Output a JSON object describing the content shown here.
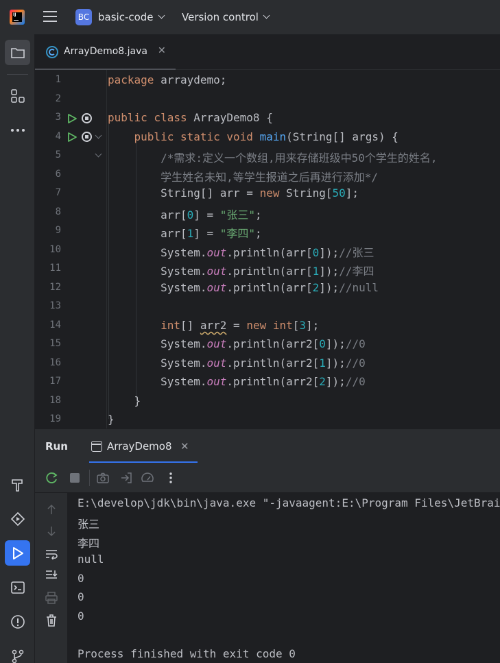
{
  "titlebar": {
    "project_badge": "BC",
    "project_name": "basic-code",
    "vcs_label": "Version control"
  },
  "editor": {
    "tab_label": "ArrayDemo8.java",
    "tab_close": "✕",
    "line_numbers": [
      "1",
      "2",
      "3",
      "4",
      "5",
      "6",
      "7",
      "8",
      "9",
      "10",
      "11",
      "12",
      "13",
      "14",
      "15",
      "16",
      "17",
      "18",
      "19"
    ]
  },
  "run_panel": {
    "title": "Run",
    "tab_label": "ArrayDemo8",
    "tab_close": "✕",
    "output": [
      "E:\\develop\\jdk\\bin\\java.exe \"-javaagent:E:\\Program Files\\JetBrains",
      "张三",
      "李四",
      "null",
      "0",
      "0",
      "0",
      "",
      "Process finished with exit code 0"
    ]
  },
  "colors": {
    "background": "#1e1f22",
    "panel": "#2b2d30",
    "keyword": "#cf8e6d",
    "function": "#56a8f5",
    "number": "#2aacb8",
    "string": "#6aab73",
    "comment": "#7a7e85",
    "field": "#c77dbb",
    "accent": "#3574f0"
  },
  "icons": [
    "folder-icon",
    "structure-icon",
    "more-icon",
    "build-icon",
    "services-icon",
    "run-icon",
    "terminal-icon",
    "problems-icon",
    "git-icon"
  ]
}
